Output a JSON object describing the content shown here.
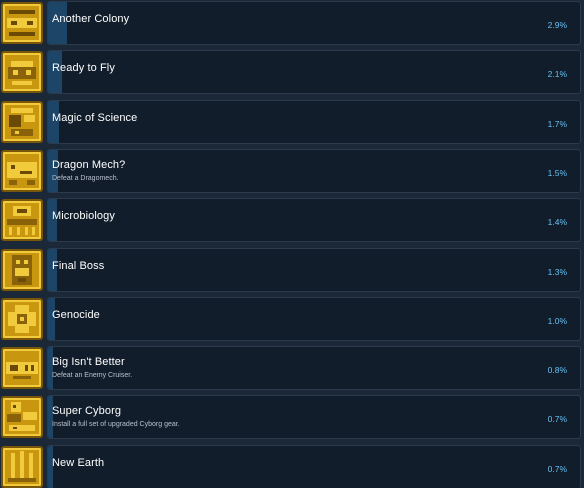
{
  "achievements": [
    {
      "title": "Another Colony",
      "description": "",
      "percent": 2.9,
      "percent_label": "2.9%",
      "icon": "colony-icon"
    },
    {
      "title": "Ready to Fly",
      "description": "",
      "percent": 2.1,
      "percent_label": "2.1%",
      "icon": "ship-icon"
    },
    {
      "title": "Magic of Science",
      "description": "",
      "percent": 1.7,
      "percent_label": "1.7%",
      "icon": "science-icon"
    },
    {
      "title": "Dragon Mech?",
      "description": "Defeat a Dragomech.",
      "percent": 1.5,
      "percent_label": "1.5%",
      "icon": "dragon-icon"
    },
    {
      "title": "Microbiology",
      "description": "",
      "percent": 1.4,
      "percent_label": "1.4%",
      "icon": "microbe-icon"
    },
    {
      "title": "Final Boss",
      "description": "",
      "percent": 1.3,
      "percent_label": "1.3%",
      "icon": "boss-icon"
    },
    {
      "title": "Genocide",
      "description": "",
      "percent": 1.0,
      "percent_label": "1.0%",
      "icon": "genocide-icon"
    },
    {
      "title": "Big Isn't Better",
      "description": "Defeat an Enemy Cruiser.",
      "percent": 0.8,
      "percent_label": "0.8%",
      "icon": "cruiser-icon"
    },
    {
      "title": "Super Cyborg",
      "description": "Install a full set of upgraded Cyborg gear.",
      "percent": 0.7,
      "percent_label": "0.7%",
      "icon": "cyborg-icon"
    },
    {
      "title": "New Earth",
      "description": "",
      "percent": 0.7,
      "percent_label": "0.7%",
      "icon": "planet-icon"
    }
  ],
  "colors": {
    "background": "#1b2838",
    "panel": "#121d2b",
    "progress_fill": "#1c4567",
    "percent_text": "#66c0f4",
    "icon_gold": "#c9960f"
  }
}
